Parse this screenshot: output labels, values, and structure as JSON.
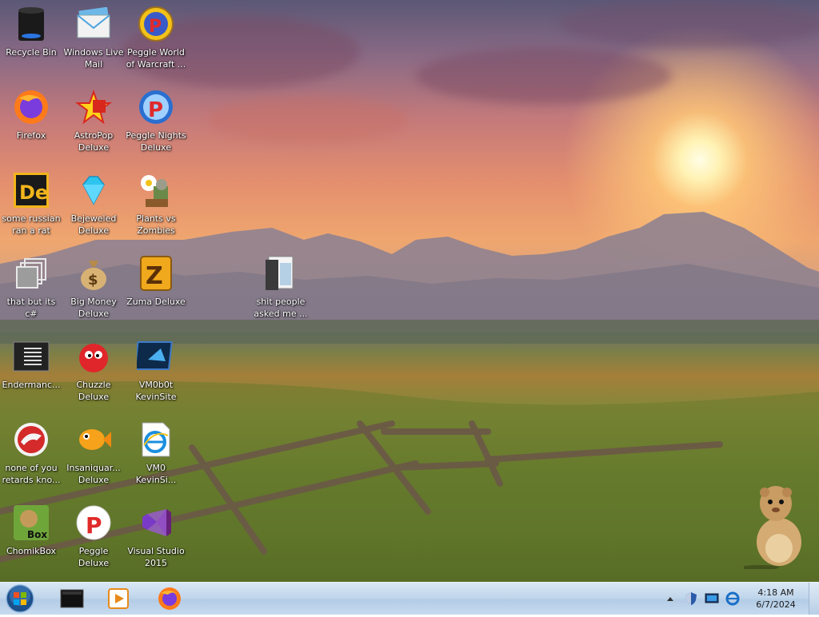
{
  "desktop": {
    "icons": [
      {
        "label": "Recycle Bin",
        "icon": "recycle-bin-icon"
      },
      {
        "label": "Windows Live\nMail",
        "icon": "mail-icon"
      },
      {
        "label": "Peggle World\nof Warcraft ...",
        "icon": "peggle-icon"
      },
      {
        "label": "Firefox",
        "icon": "firefox-icon"
      },
      {
        "label": "AstroPop\nDeluxe",
        "icon": "astropop-icon"
      },
      {
        "label": "Peggle Nights\nDeluxe",
        "icon": "peggle-nights-icon"
      },
      {
        "label": "some russian\nran a rat",
        "icon": "de-icon"
      },
      {
        "label": "Bejeweled\nDeluxe",
        "icon": "gem-icon"
      },
      {
        "label": "Plants vs\nZombies",
        "icon": "plants-icon"
      },
      {
        "label": "that but its c#",
        "icon": "stack-icon"
      },
      {
        "label": "Big Money\nDeluxe",
        "icon": "money-bag-icon"
      },
      {
        "label": "Zuma Deluxe",
        "icon": "zuma-icon"
      },
      {
        "label": "shit people\nasked me ...",
        "icon": "folder-icon"
      },
      {
        "label": "Endermanc...",
        "icon": "console-icon"
      },
      {
        "label": "Chuzzle\nDeluxe",
        "icon": "chuzzle-icon"
      },
      {
        "label": "VM0b0t\nKevinSite",
        "icon": "vm-icon"
      },
      {
        "label": "none of you\nretards kno...",
        "icon": "dino-icon"
      },
      {
        "label": "Insaniquar...\nDeluxe",
        "icon": "fish-icon"
      },
      {
        "label": "VM0\nKevinSi...",
        "icon": "ie-icon"
      },
      {
        "label": "ChomikBox",
        "icon": "chomikbox-icon"
      },
      {
        "label": "Peggle Deluxe",
        "icon": "peggle-deluxe-icon"
      },
      {
        "label": "Visual Studio\n2015",
        "icon": "visual-studio-icon"
      }
    ]
  },
  "taskbar": {
    "start": {
      "icon": "windows-start-icon"
    },
    "pinned": [
      {
        "name": "terminal-icon"
      },
      {
        "name": "media-player-icon"
      },
      {
        "name": "firefox-icon"
      }
    ],
    "tray": {
      "show_hidden_icon": "chevron-up-icon",
      "icons": [
        "shield-icon",
        "monitor-icon",
        "network-icon"
      ],
      "time": "4:18 AM",
      "date": "6/7/2024"
    }
  }
}
